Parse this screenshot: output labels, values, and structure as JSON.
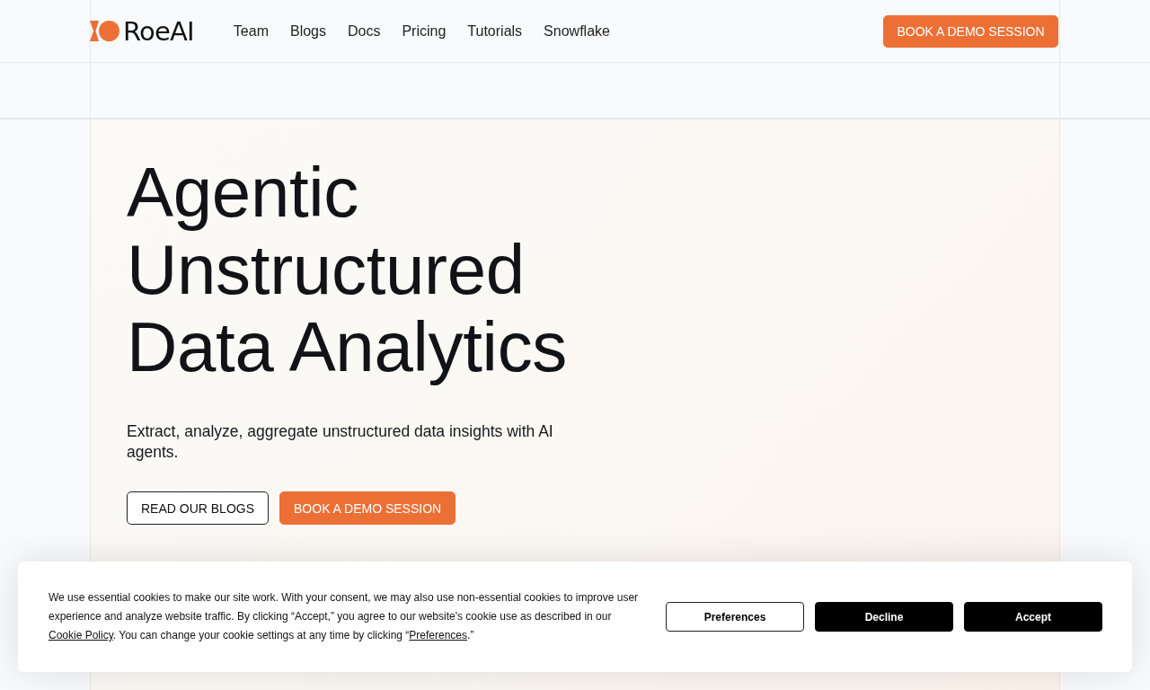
{
  "header": {
    "brand": "RoeAI",
    "nav_links": [
      "Team",
      "Blogs",
      "Docs",
      "Pricing",
      "Tutorials",
      "Snowflake"
    ],
    "cta": "BOOK A DEMO SESSION"
  },
  "hero": {
    "title": "Agentic Unstructured Data Analytics",
    "subtitle": "Extract, analyze, aggregate unstructured data insights with AI agents.",
    "buttons": [
      {
        "label": "READ OUR BLOGS",
        "kind": "outline"
      },
      {
        "label": "BOOK A DEMO SESSION",
        "kind": "primary"
      }
    ]
  },
  "cookie_banner": {
    "message": [
      {
        "kind": "text",
        "text": "We use essential cookies to make our site work. With your consent, we may also use non-essential cookies to improve user experience and analyze website traffic. By clicking “Accept,” you agree to our website's cookie use as described in our "
      },
      {
        "kind": "link",
        "text": "Cookie Policy"
      },
      {
        "kind": "text",
        "text": ". You can change your cookie settings at any time by clicking “"
      },
      {
        "kind": "link",
        "text": "Preferences"
      },
      {
        "kind": "text",
        "text": ".”"
      }
    ],
    "buttons": [
      {
        "label": "Preferences",
        "kind": "outline"
      },
      {
        "label": "Decline",
        "kind": "solid"
      },
      {
        "label": "Accept",
        "kind": "solid"
      }
    ]
  }
}
